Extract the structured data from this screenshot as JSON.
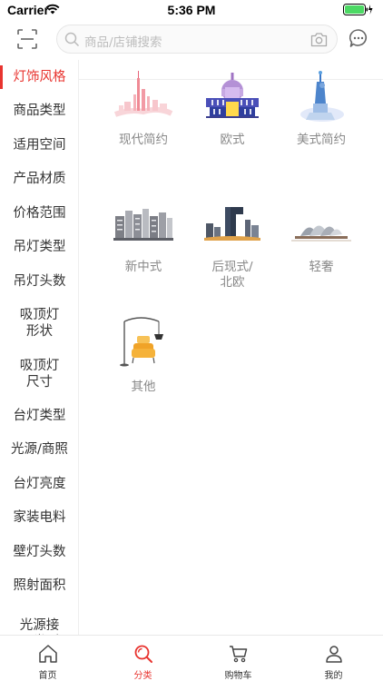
{
  "status_bar": {
    "carrier": "Carrier",
    "time": "5:36 PM"
  },
  "search": {
    "placeholder": "商品/店铺搜索"
  },
  "icons": {
    "scan": "scan-icon",
    "search": "search-icon",
    "camera": "camera-icon",
    "message": "message-icon",
    "wifi": "wifi-icon",
    "battery": "battery-icon"
  },
  "colors": {
    "accent": "#e8342f",
    "battery": "#4cd964"
  },
  "sidebar": {
    "items": [
      {
        "label": "灯饰风格",
        "active": true
      },
      {
        "label": "商品类型"
      },
      {
        "label": "适用空间"
      },
      {
        "label": "产品材质"
      },
      {
        "label": "价格范围"
      },
      {
        "label": "吊灯类型"
      },
      {
        "label": "吊灯头数"
      },
      {
        "label": "吸顶灯\n形状"
      },
      {
        "label": "吸顶灯\n尺寸"
      },
      {
        "label": "台灯类型"
      },
      {
        "label": "光源/商照"
      },
      {
        "label": "台灯亮度"
      },
      {
        "label": "家装电料"
      },
      {
        "label": "壁灯头数"
      },
      {
        "label": "照射面积"
      },
      {
        "label": "光源接\n口类型"
      }
    ]
  },
  "categories": [
    {
      "label": "现代简约",
      "image": "modern-city-skyline"
    },
    {
      "label": "欧式",
      "image": "capitol-building"
    },
    {
      "label": "美式简约",
      "image": "statue-of-liberty"
    },
    {
      "label": "新中式",
      "image": "chinese-city-buildings"
    },
    {
      "label": "后现式/\n北欧",
      "image": "cctv-tower-skyline"
    },
    {
      "label": "轻奢",
      "image": "sydney-opera-house"
    },
    {
      "label": "其他",
      "image": "floor-lamp-sofa"
    }
  ],
  "tabbar": {
    "items": [
      {
        "label": "首页",
        "icon": "home-icon"
      },
      {
        "label": "分类",
        "icon": "category-search-icon",
        "active": true
      },
      {
        "label": "购物车",
        "icon": "cart-icon"
      },
      {
        "label": "我的",
        "icon": "profile-icon"
      }
    ]
  }
}
